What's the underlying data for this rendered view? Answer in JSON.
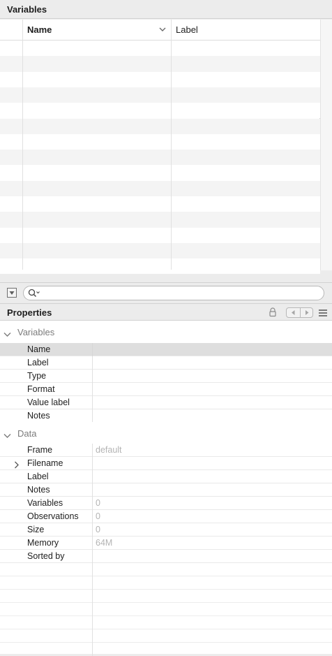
{
  "variables_panel": {
    "title": "Variables",
    "columns": {
      "name": "Name",
      "label": "Label"
    },
    "rows": [],
    "search": {
      "value": "",
      "placeholder": ""
    }
  },
  "properties_panel": {
    "title": "Properties",
    "groups": {
      "variables": {
        "label": "Variables",
        "rows": [
          {
            "key": "Name",
            "value": ""
          },
          {
            "key": "Label",
            "value": ""
          },
          {
            "key": "Type",
            "value": ""
          },
          {
            "key": "Format",
            "value": ""
          },
          {
            "key": "Value label",
            "value": ""
          },
          {
            "key": "Notes",
            "value": ""
          }
        ]
      },
      "data": {
        "label": "Data",
        "rows": [
          {
            "key": "Frame",
            "value": "default"
          },
          {
            "key": "Filename",
            "value": ""
          },
          {
            "key": "Label",
            "value": ""
          },
          {
            "key": "Notes",
            "value": ""
          },
          {
            "key": "Variables",
            "value": "0"
          },
          {
            "key": "Observations",
            "value": "0"
          },
          {
            "key": "Size",
            "value": "0"
          },
          {
            "key": "Memory",
            "value": "64M"
          },
          {
            "key": "Sorted by",
            "value": ""
          }
        ]
      }
    }
  },
  "icons": {
    "sort": "chevron-down-icon",
    "filter": "filter-icon",
    "search": "search-icon",
    "lock": "lock-icon",
    "back": "back-arrow-icon",
    "forward": "forward-arrow-icon",
    "menu": "menu-icon",
    "group_toggle": "chevron-down-icon",
    "expand": "chevron-right-icon"
  },
  "colors": {
    "panel_bg": "#ececec",
    "stripe": "#f4f4f4",
    "selected_row": "#dedede",
    "muted_value": "#b4b4b4"
  }
}
